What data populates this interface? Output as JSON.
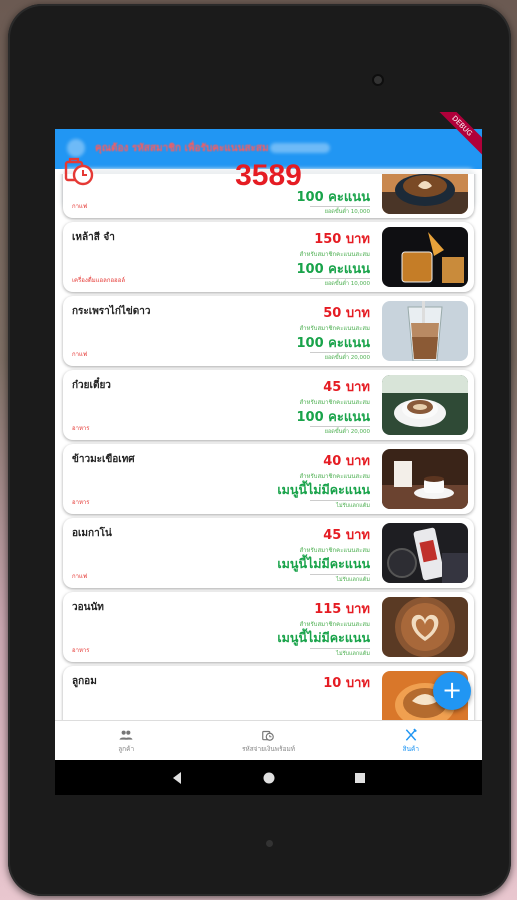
{
  "appbar": {
    "hint": "คุณต้อง รหัสสมาชิก เพื่อรับคะแนนสะสม"
  },
  "points": {
    "value": "3589"
  },
  "debug_banner": "DEBUG",
  "products": [
    {
      "name": "",
      "category": "กาแฟ",
      "price": "",
      "points_label": "",
      "points": "100 คะแนน",
      "sub": "ยอดขั้นต่ำ 10,000",
      "photo": "latte-art-cup"
    },
    {
      "name": "เหล้าสี จำ",
      "category": "เครื่องดื่มแอลกอฮอล์",
      "price": "150 บาท",
      "points_label": "สำหรับสมาชิกคะแนนสะสม",
      "points": "100 คะแนน",
      "sub": "ยอดขั้นต่ำ 10,000",
      "photo": "whiskey-pour"
    },
    {
      "name": "กระเพราไก่ไข่ดาว",
      "category": "กาแฟ",
      "price": "50 บาท",
      "points_label": "สำหรับสมาชิกคะแนนสะสม",
      "points": "100 คะแนน",
      "sub": "ยอดขั้นต่ำ 20,000",
      "photo": "iced-coffee"
    },
    {
      "name": "ก๋วยเตี๋ยว",
      "category": "อาหาร",
      "price": "45 บาท",
      "points_label": "สำหรับสมาชิกคะแนนสะสม",
      "points": "100 คะแนน",
      "sub": "ยอดขั้นต่ำ 20,000",
      "photo": "cappuccino"
    },
    {
      "name": "ข้าวมะเขือเทศ",
      "category": "อาหาร",
      "price": "40 บาท",
      "points_label": "สำหรับสมาชิกคะแนนสะสม",
      "points": "เมนูนี้ไม่มีคะแนน",
      "sub": "ไม่รับแลกแต้ม",
      "photo": "espresso-cups"
    },
    {
      "name": "อเมกาโน่",
      "category": "กาแฟ",
      "price": "45 บาท",
      "points_label": "สำหรับสมาชิกคะแนนสะสม",
      "points": "เมนูนี้ไม่มีคะแนน",
      "sub": "ไม่รับแลกแต้ม",
      "photo": "coffee-can-car"
    },
    {
      "name": "วอนนัท",
      "category": "อาหาร",
      "price": "115 บาท",
      "points_label": "สำหรับสมาชิกคะแนนสะสม",
      "points": "เมนูนี้ไม่มีคะแนน",
      "sub": "ไม่รับแลกแต้ม",
      "photo": "heart-latte"
    },
    {
      "name": "ลูกอม",
      "category": "",
      "price": "10 บาท",
      "points_label": "",
      "points": "",
      "sub": "",
      "photo": "latte-art-orange"
    }
  ],
  "fab": {
    "label": "+"
  },
  "bottom_nav": [
    {
      "label": "ลูกค้า",
      "icon": "people-icon",
      "active": false
    },
    {
      "label": "รหัสจ่ายเงินพร้อมท์",
      "icon": "clock-bag-icon",
      "active": false
    },
    {
      "label": "สินค้า",
      "icon": "fork-knife-icon",
      "active": true
    }
  ],
  "colors": {
    "primary": "#2196f3",
    "price_red": "#e51c23",
    "points_green": "#19a34a"
  }
}
